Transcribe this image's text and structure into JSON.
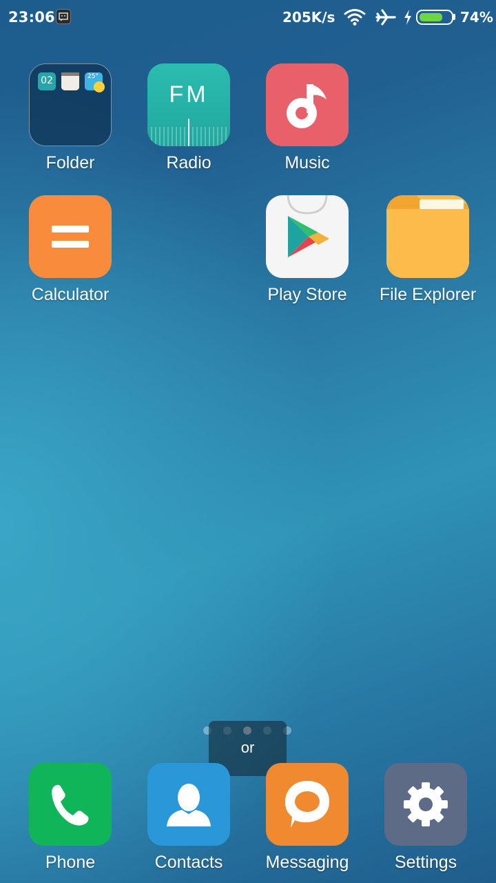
{
  "status_bar": {
    "time": "23:06",
    "net_speed": "205K/s",
    "battery_percent": "74%",
    "battery_level": 0.74,
    "icons": [
      "notification-icon",
      "wifi-icon",
      "airplane-icon",
      "charging-icon",
      "battery-icon"
    ]
  },
  "home": {
    "apps": [
      {
        "label": "Folder",
        "icon": "folder-icon",
        "mini_date": "02",
        "mini_temp": "25°"
      },
      {
        "label": "Radio",
        "icon": "radio-icon",
        "glyph": "FM"
      },
      {
        "label": "Music",
        "icon": "music-icon"
      },
      {
        "label": "Calculator",
        "icon": "calculator-icon"
      },
      {
        "label": "Play Store",
        "icon": "play-store-icon"
      },
      {
        "label": "File Explorer",
        "icon": "file-explorer-icon"
      }
    ]
  },
  "pager": {
    "pages": 5,
    "active_index": 2
  },
  "toast": {
    "text": "or"
  },
  "dock": {
    "apps": [
      {
        "label": "Phone",
        "icon": "phone-icon"
      },
      {
        "label": "Contacts",
        "icon": "contacts-icon"
      },
      {
        "label": "Messaging",
        "icon": "messaging-icon"
      },
      {
        "label": "Settings",
        "icon": "settings-icon"
      }
    ]
  },
  "colors": {
    "radio": "#23b3a8",
    "music": "#e8606a",
    "calculator": "#f98b3c",
    "file_explorer": "#fdbb4b",
    "phone": "#10b55a",
    "contacts": "#2a97d9",
    "messaging": "#f08a30",
    "settings": "#5d6b86",
    "battery": "#6ed63e"
  }
}
